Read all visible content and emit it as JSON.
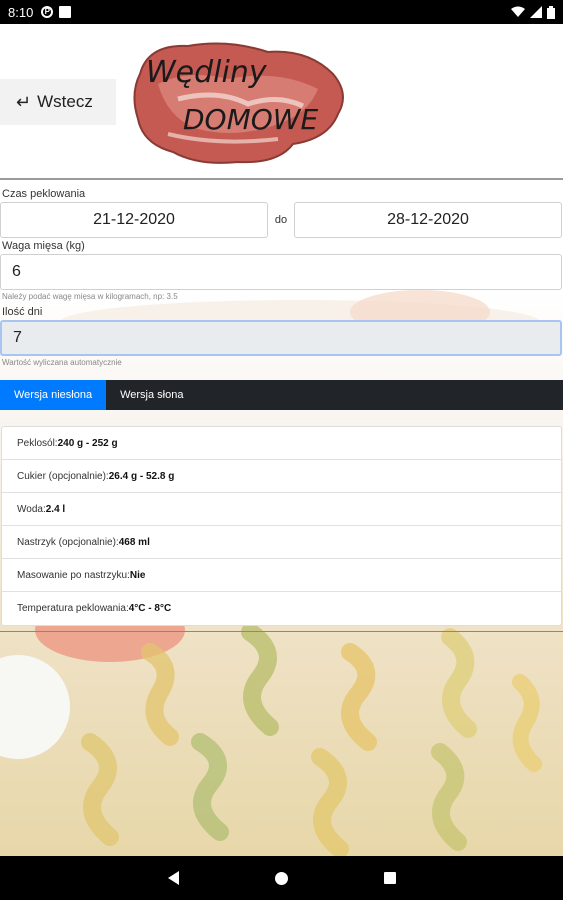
{
  "status_bar": {
    "time": "8:10",
    "icons": [
      "parking-icon",
      "sd-card-icon",
      "wifi-icon",
      "signal-icon",
      "battery-icon"
    ]
  },
  "header": {
    "back_arrow": "↵",
    "back_label": "Wstecz",
    "logo_text_top": "Wędliny",
    "logo_text_bottom": "DOMOWE"
  },
  "form": {
    "curing_time_label": "Czas peklowania",
    "date_from": "21-12-2020",
    "date_separator": "do",
    "date_to": "28-12-2020",
    "meat_weight_label": "Waga mięsa (kg)",
    "meat_weight_value": "6",
    "meat_weight_hint": "Należy podać wagę mięsa w kilogramach, np: 3.5",
    "days_label": "Ilość dni",
    "days_value": "7",
    "days_hint": "Wartość wyliczana automatycznie"
  },
  "tabs": [
    {
      "label": "Wersja niesłona",
      "active": true
    },
    {
      "label": "Wersja słona",
      "active": false
    }
  ],
  "results": [
    {
      "label": "Peklosól: ",
      "value": "240 g - 252 g"
    },
    {
      "label": "Cukier (opcjonalnie): ",
      "value": "26.4 g - 52.8 g"
    },
    {
      "label": "Woda: ",
      "value": "2.4 l"
    },
    {
      "label": "Nastrzyk (opcjonalnie): ",
      "value": "468 ml"
    },
    {
      "label": "Masowanie po nastrzyku: ",
      "value": "Nie"
    },
    {
      "label": "Temperatura peklowania: ",
      "value": "4°C - 8°C"
    }
  ],
  "colors": {
    "accent": "#007bff",
    "tab_bar": "#212529"
  }
}
